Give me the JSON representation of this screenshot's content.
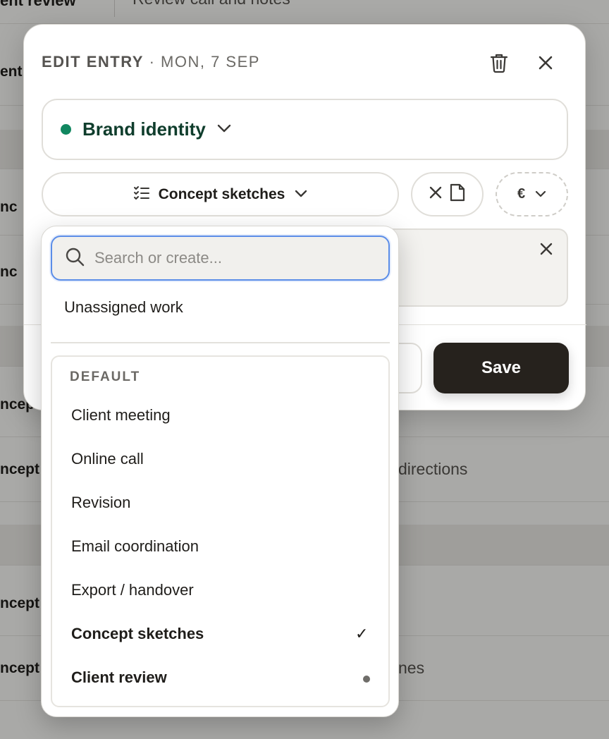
{
  "background": {
    "top_left": "ent review",
    "top_right": "Review call and notes",
    "rows": [
      {
        "left": "ent"
      },
      {
        "left": "nc"
      },
      {
        "left": "nc"
      },
      {
        "left": "ncep"
      },
      {
        "left": "ncept",
        "right": "directions"
      },
      {
        "left": "ncept"
      },
      {
        "left": "ncept",
        "right": "nes"
      }
    ]
  },
  "modal": {
    "title": "EDIT ENTRY",
    "date": " · MON, 7 SEP",
    "project": {
      "name": "Brand identity",
      "color": "#118760"
    },
    "task": {
      "label": "Concept sketches"
    },
    "currency_symbol": "€",
    "save_label": "Save"
  },
  "dropdown": {
    "search_placeholder": "Search or create...",
    "unassigned_label": "Unassigned work",
    "group_label": "DEFAULT",
    "items": [
      {
        "label": "Client meeting"
      },
      {
        "label": "Online call"
      },
      {
        "label": "Revision"
      },
      {
        "label": "Email coordination"
      },
      {
        "label": "Export / handover"
      },
      {
        "label": "Concept sketches",
        "selected": true
      },
      {
        "label": "Client review",
        "recent": true
      }
    ],
    "check_glyph": "✓"
  },
  "colors": {
    "accent_focus": "#5b8de8",
    "save_bg": "#26221d",
    "project_dot": "#118760"
  }
}
